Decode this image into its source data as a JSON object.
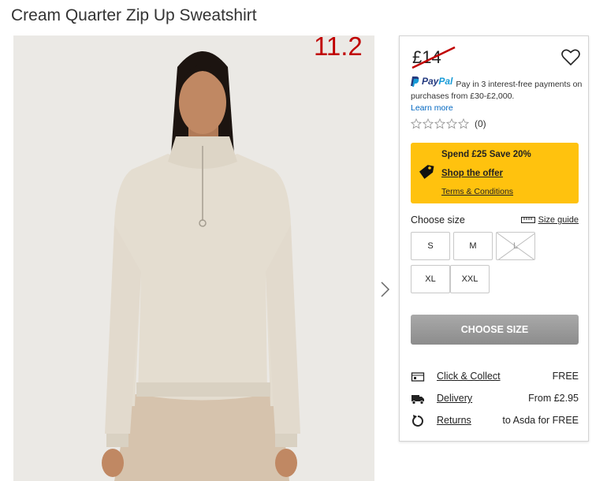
{
  "page": {
    "title": "Cream Quarter Zip Up Sweatshirt"
  },
  "annotation": "11.2",
  "price": {
    "current": "£14",
    "struck": true
  },
  "paypal": {
    "brand_pay": "Pay",
    "brand_pal": "Pal",
    "message": "Pay in 3 interest-free payments on purchases from £30-£2,000.",
    "learn_more": "Learn more"
  },
  "rating": {
    "stars": 0,
    "max": 5,
    "count": "(0)"
  },
  "offer": {
    "headline": "Spend £25 Save 20%",
    "shop_link": "Shop the offer",
    "terms_link": "Terms & Conditions",
    "background": "#ffc20e"
  },
  "size": {
    "label": "Choose size",
    "guide": "Size guide",
    "options": [
      {
        "label": "S",
        "available": true
      },
      {
        "label": "M",
        "available": true
      },
      {
        "label": "L",
        "available": false
      },
      {
        "label": "XL",
        "available": true
      },
      {
        "label": "XXL",
        "available": true
      }
    ]
  },
  "cta": {
    "label": "CHOOSE SIZE"
  },
  "delivery": [
    {
      "icon": "click-collect-icon",
      "link": "Click & Collect",
      "value": "FREE"
    },
    {
      "icon": "truck-icon",
      "link": "Delivery",
      "value": "From £2.95"
    },
    {
      "icon": "return-icon",
      "link": "Returns",
      "value": "to Asda for FREE"
    }
  ],
  "colors": {
    "strike": "#c00000",
    "annotation": "#c00000",
    "paypal_blue": "#253b80",
    "link_blue": "#0066c0"
  }
}
